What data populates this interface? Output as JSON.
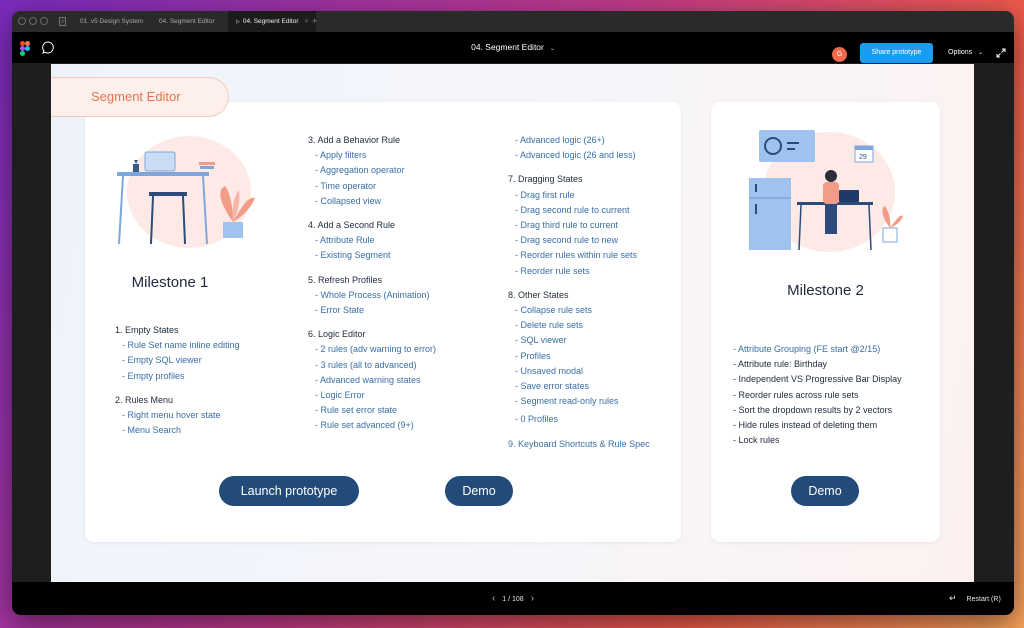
{
  "tabs": [
    {
      "label": "01. v5 Design System"
    },
    {
      "label": "04. Segment Editor"
    },
    {
      "label": "04. Segment Editor",
      "close": "×"
    }
  ],
  "new_tab": "+",
  "toolbar": {
    "title": "04. Segment Editor",
    "avatar_initial": "G",
    "share_label": "Share prototype",
    "options_label": "Options"
  },
  "header_tab": "Segment Editor",
  "milestone1": {
    "title": "Milestone 1",
    "col1": [
      {
        "label": "1. Empty States",
        "items": [
          "- Rule Set name inline editing",
          "- Empty SQL viewer",
          "- Empty profiles"
        ]
      },
      {
        "label": "2. Rules Menu",
        "items": [
          "- Right menu hover state",
          "- Menu Search"
        ]
      }
    ],
    "col2": [
      {
        "label": "3. Add a Behavior Rule",
        "items": [
          "- Apply filters",
          "- Aggregation operator",
          "- Time operator",
          "- Collapsed view"
        ]
      },
      {
        "label": "4. Add a Second Rule",
        "items": [
          "- Attribute Rule",
          "- Existing Segment"
        ]
      },
      {
        "label": "5. Refresh Profiles",
        "items": [
          "- Whole Process (Animation)",
          "- Error State"
        ]
      },
      {
        "label": "6. Logic Editor",
        "items": [
          "- 2 rules (adv warning to error)",
          "- 3 rules (all to advanced)",
          "- Advanced warning states",
          "- Logic Error",
          "- Rule set error state",
          "- Rule set advanced (9+)"
        ]
      }
    ],
    "col3_top": [
      "- Advanced logic (26+)",
      "- Advanced logic (26 and less)"
    ],
    "col3": [
      {
        "label": "7. Dragging States",
        "items": [
          "- Drag first rule",
          "- Drag second rule to current",
          "- Drag third rule to current",
          "- Drag second rule to new",
          "- Reorder rules within rule sets",
          "- Reorder rule sets"
        ]
      },
      {
        "label": "8. Other States",
        "items": [
          "- Collapse rule sets",
          "- Delete rule sets",
          "- SQL viewer",
          "- Profiles",
          "- Unsaved modal",
          "- Save error states",
          "- Segment read-only rules",
          "- 0 Profiles"
        ]
      }
    ],
    "col3_last": "9. Keyboard Shortcuts & Rule Spec",
    "launch_label": "Launch prototype",
    "demo_label": "Demo"
  },
  "milestone2": {
    "title": "Milestone 2",
    "calendar_day": "29",
    "items": [
      {
        "text": "- Attribute Grouping (FE start @2/15)",
        "highlight": true
      },
      {
        "text": "- Attribute rule: Birthday",
        "highlight": false
      },
      {
        "text": "- Independent VS Progressive Bar Display",
        "highlight": false
      },
      {
        "text": "- Reorder rules across rule sets",
        "highlight": false
      },
      {
        "text": "- Sort the dropdown results by 2 vectors",
        "highlight": false
      },
      {
        "text": "- Hide rules instead of deleting them",
        "highlight": false
      },
      {
        "text": "- Lock rules",
        "highlight": false
      }
    ],
    "demo_label": "Demo"
  },
  "pager": {
    "text": "1 / 108"
  },
  "restart_label": "Restart (R)",
  "colors": {
    "accent_blue": "#1a9cf3",
    "button_navy": "#234b7a",
    "link_blue": "#3a6ea5",
    "header_orange": "#e4744e"
  }
}
